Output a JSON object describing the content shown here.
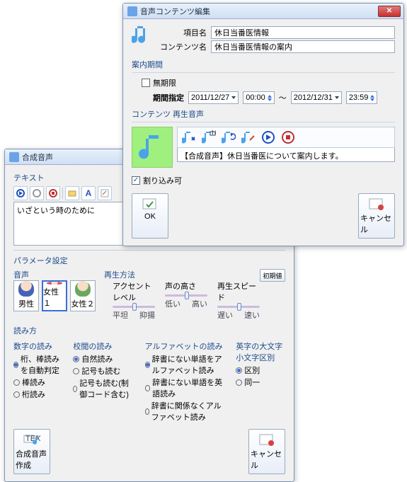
{
  "front": {
    "title": "音声コンテンツ編集",
    "field_item_label": "項目名",
    "field_item_value": "休日当番医情報",
    "field_content_label": "コンテンツ名",
    "field_content_value": "休日当番医情報の案内",
    "period_group": "案内期間",
    "unlimited_label": "無期限",
    "period_label": "期間指定",
    "date_from": "2011/12/27",
    "time_from": "00:00",
    "tilde": "～",
    "date_to": "2012/12/31",
    "time_to": "23:59",
    "content_audio_group": "コンテンツ 再生音声",
    "audio_desc": "【合成音声】休日当番医について案内します。",
    "interrupt_label": "割り込み可",
    "ok": "OK",
    "cancel": "キャンセル"
  },
  "back": {
    "title": "合成音声",
    "text_label": "テキスト",
    "text_value": "いざという時のために",
    "param_label": "パラメータ設定",
    "voice_label": "音声",
    "voice1": "男性",
    "voice2": "女性１",
    "voice3": "女性２",
    "play_label": "再生方法",
    "slider_accent": "アクセントレベル",
    "slider_accent_lo": "平坦",
    "slider_accent_hi": "抑揚",
    "slider_pitch": "声の高さ",
    "slider_pitch_lo": "低い",
    "slider_pitch_hi": "高い",
    "slider_speed": "再生スピード",
    "slider_speed_lo": "遅い",
    "slider_speed_hi": "速い",
    "reset": "初期値",
    "reading_label": "読み方",
    "col1_h": "数字の読み",
    "col1_o1": "桁、棒読みを自動判定",
    "col1_o2": "棒読み",
    "col1_o3": "桁読み",
    "col2_h": "校閲の読み",
    "col2_o1": "自然読み",
    "col2_o2": "記号も読む",
    "col2_o3": "記号も読む(制御コード含む)",
    "col3_h": "アルファベットの読み",
    "col3_o1": "辞書にない単語をアルファベット読み",
    "col3_o2": "辞書にない単語を英語読み",
    "col3_o3": "辞書に関係なくアルファベット読み",
    "col4_h": "英字の大文字小文字区別",
    "col4_o1": "区別",
    "col4_o2": "同一",
    "create": "合成音声作成",
    "cancel": "キャンセル"
  }
}
